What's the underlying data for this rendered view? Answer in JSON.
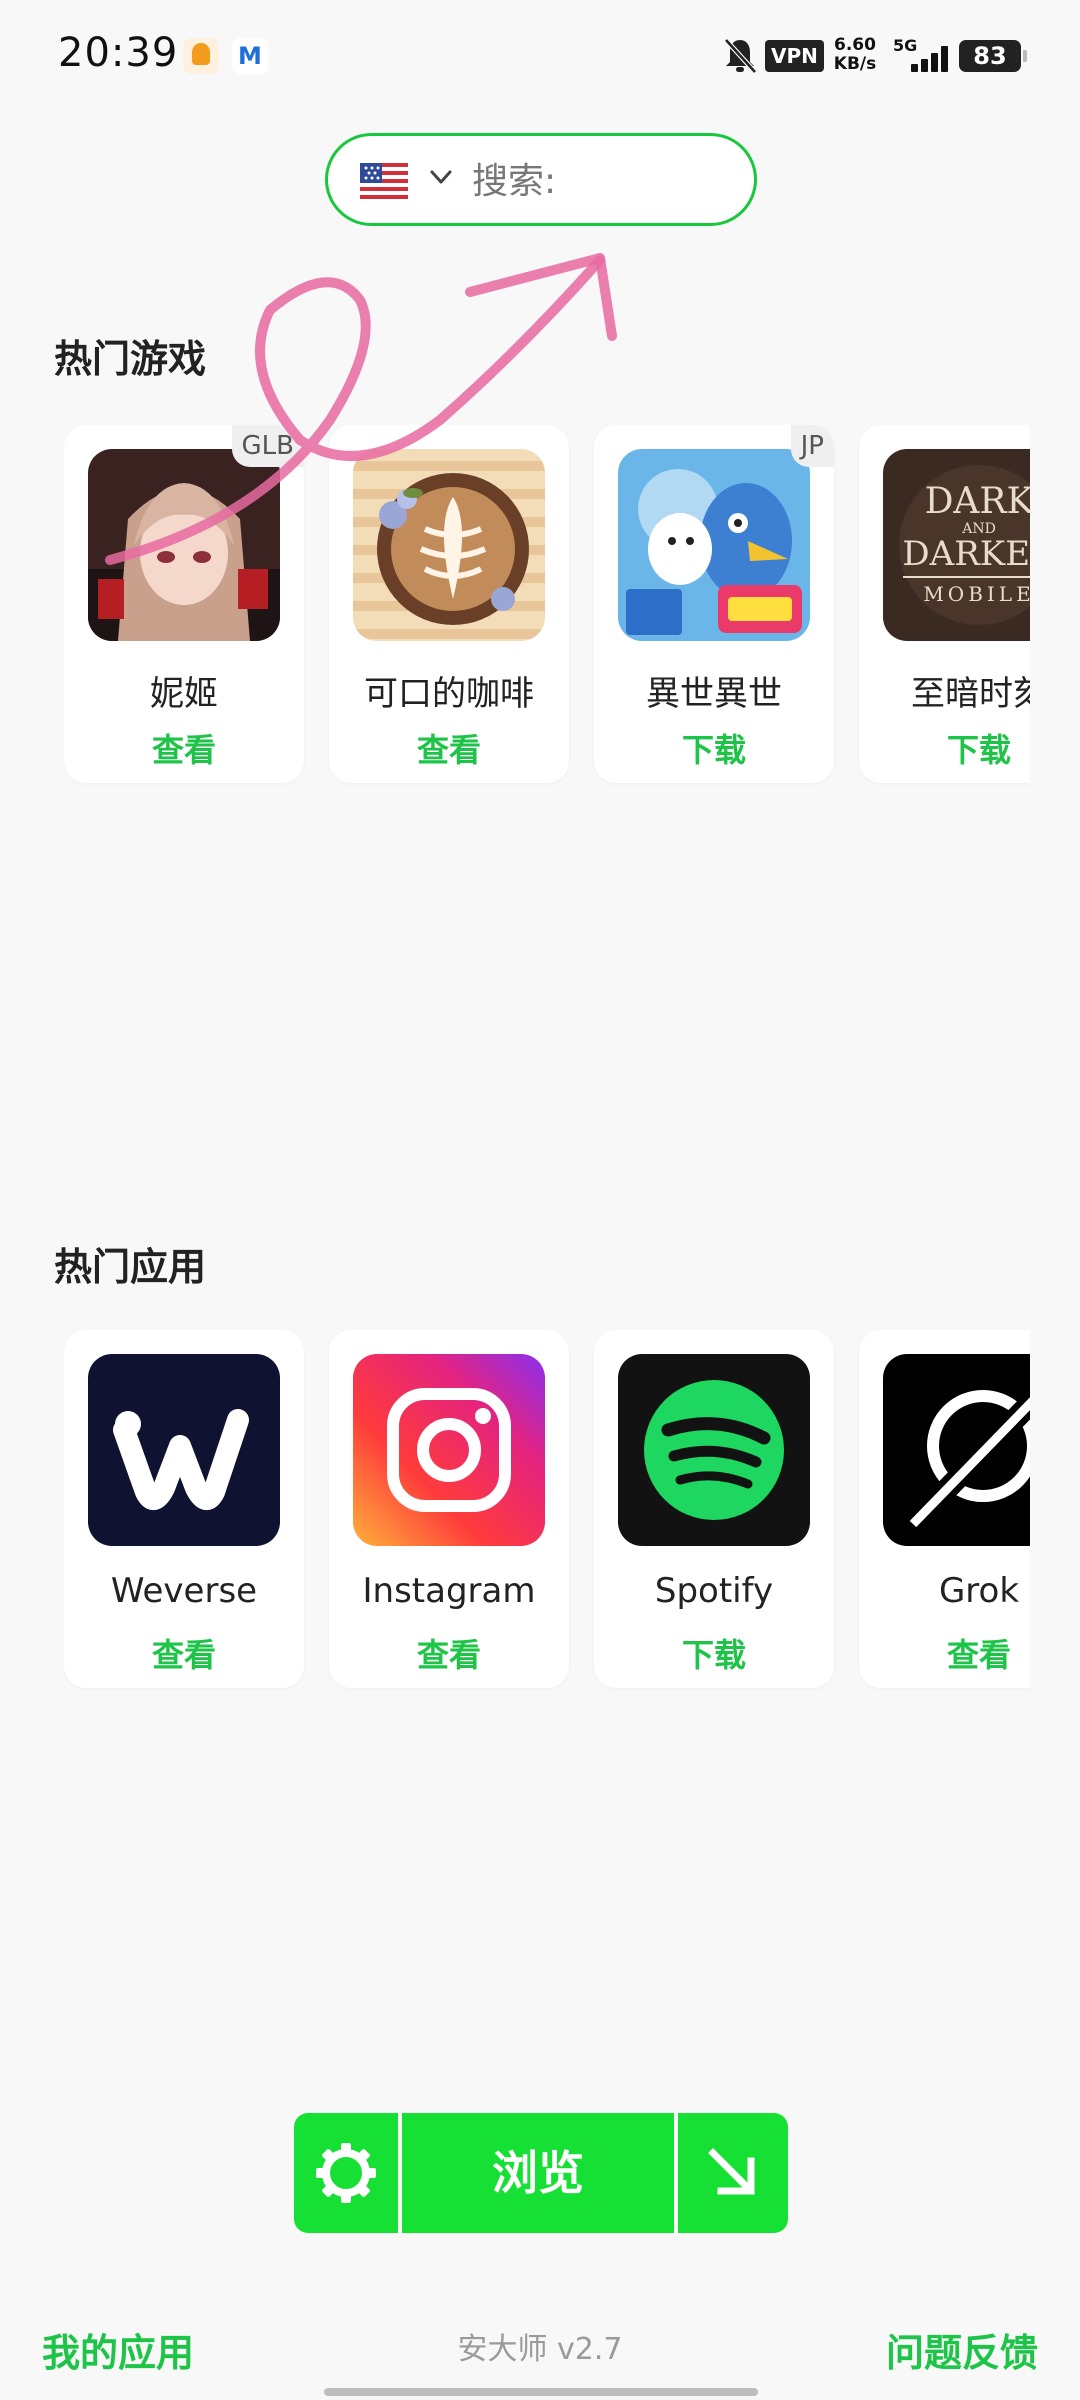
{
  "status_bar": {
    "time": "20:39",
    "notif_2_letter": "M",
    "vpn": "VPN",
    "speed_value": "6.60",
    "speed_unit": "KB/s",
    "network": "5G",
    "battery": "83"
  },
  "search": {
    "placeholder": "搜索:",
    "flag": "🇺🇸",
    "accent": "#18c83c"
  },
  "hot_games": {
    "title": "热门游戏",
    "items": [
      {
        "name": "妮姬",
        "action": "查看",
        "region": "GLB",
        "icon": "nikke-icon"
      },
      {
        "name": "可口的咖啡",
        "action": "查看",
        "region": "",
        "icon": "coffee-icon"
      },
      {
        "name": "異世異世",
        "action": "下载",
        "region": "JP",
        "icon": "isekai-icon"
      },
      {
        "name": "至暗时刻",
        "action": "下载",
        "region": "",
        "icon": "dark-and-darker-icon",
        "icon_text": [
          "DARK",
          "AND",
          "DARKER",
          "MOBILE"
        ]
      }
    ]
  },
  "hot_apps": {
    "title": "热门应用",
    "items": [
      {
        "name": "Weverse",
        "action": "查看",
        "icon": "weverse-icon"
      },
      {
        "name": "Instagram",
        "action": "查看",
        "icon": "instagram-icon"
      },
      {
        "name": "Spotify",
        "action": "下载",
        "icon": "spotify-icon"
      },
      {
        "name": "Grok",
        "action": "查看",
        "icon": "grok-icon"
      }
    ]
  },
  "action_bar": {
    "browse_label": "浏览",
    "color": "#15e033"
  },
  "footer": {
    "my_apps": "我的应用",
    "version": "安大师 v2.7",
    "feedback": "问题反馈"
  }
}
